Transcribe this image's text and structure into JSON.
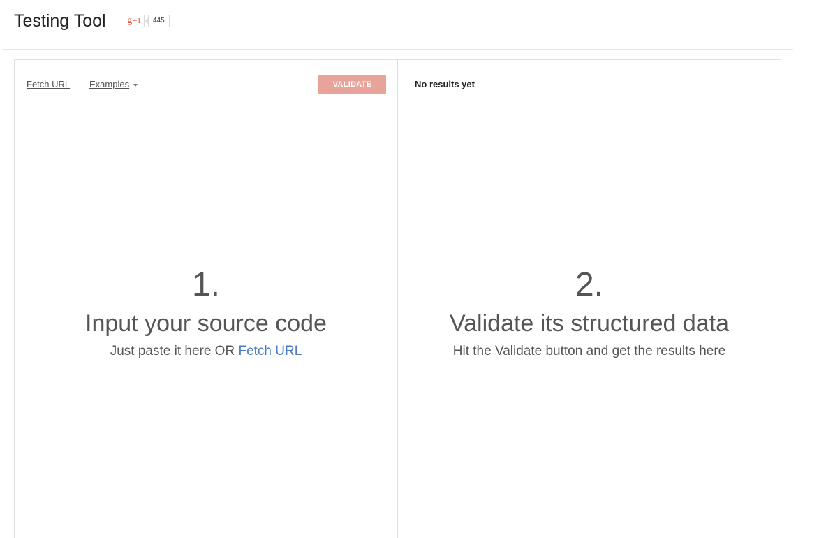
{
  "header": {
    "title": "Testing Tool",
    "gplus_label": "+1",
    "gplus_count": "445"
  },
  "left": {
    "fetch_url": "Fetch URL",
    "examples": "Examples",
    "validate": "VALIDATE",
    "step_number": "1.",
    "heading": "Input your source code",
    "sub_prefix": "Just paste it here OR ",
    "sub_link": "Fetch URL"
  },
  "right": {
    "status": "No results yet",
    "step_number": "2.",
    "heading": "Validate its structured data",
    "sub": "Hit the Validate button and get the results here"
  },
  "colors": {
    "validate_bg": "#e8a49a",
    "link_blue": "#4a7bc4",
    "gplus_red": "#dd4b39"
  }
}
